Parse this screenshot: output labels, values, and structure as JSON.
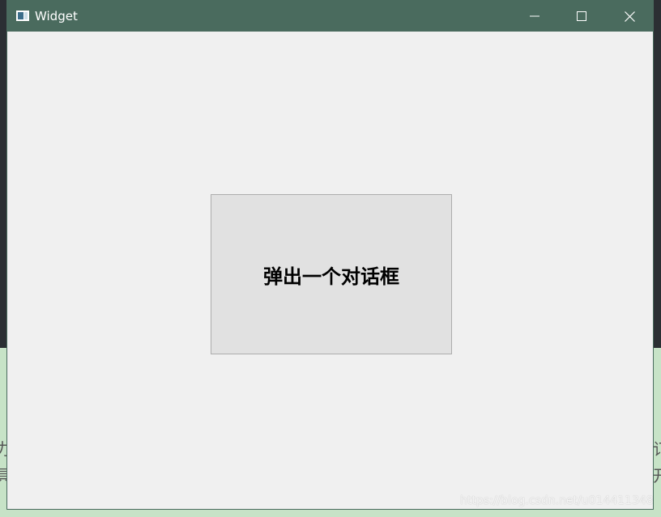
{
  "window": {
    "title": "Widget",
    "titlebar_color": "#4a6b5e",
    "client_color": "#f0f0f0",
    "controls": {
      "minimize_icon": "minimize-icon",
      "maximize_icon": "maximize-icon",
      "close_icon": "close-icon"
    }
  },
  "main": {
    "popup_button_label": "弹出一个对话框"
  },
  "background": {
    "left_glyphs": [
      "力",
      "具"
    ],
    "right_glyphs": [
      "订",
      "开"
    ]
  },
  "watermark": {
    "text": "https://blog.csdn.net/u014411348"
  }
}
